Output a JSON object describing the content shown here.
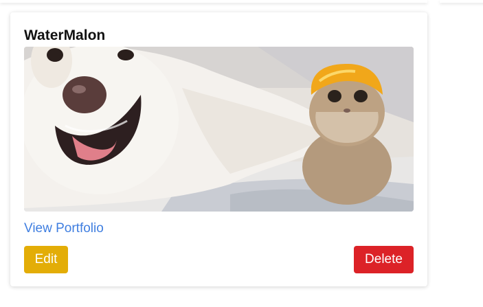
{
  "card": {
    "title": "WaterMalon",
    "image_alt": "dog-and-cat-photo",
    "link_label": "View Portfolio",
    "edit_label": "Edit",
    "delete_label": "Delete"
  },
  "colors": {
    "link": "#3f7ee0",
    "edit": "#e3ad07",
    "delete": "#dc2227"
  }
}
